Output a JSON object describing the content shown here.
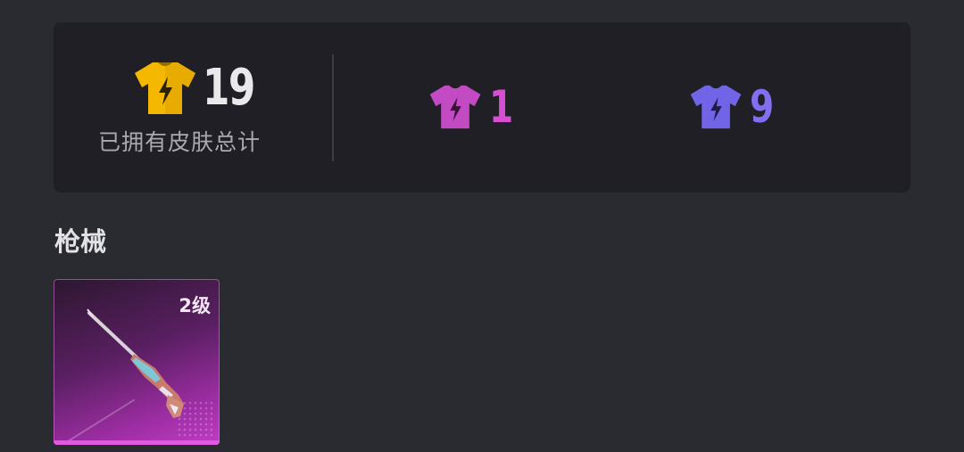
{
  "stats": {
    "total": {
      "count": "19",
      "label": "已拥有皮肤总计",
      "icon": "shirt-lightning-icon",
      "color": "#f5b800"
    },
    "pink": {
      "count": "1",
      "icon": "shirt-lightning-icon",
      "color": "#d64fd3"
    },
    "purple": {
      "count": "9",
      "icon": "shirt-lightning-icon",
      "color": "#8070f0"
    }
  },
  "section": {
    "title": "枪械"
  },
  "items": [
    {
      "level": "2级",
      "icon": "rifle-icon",
      "rarity_color": "#bf3dc4"
    }
  ]
}
